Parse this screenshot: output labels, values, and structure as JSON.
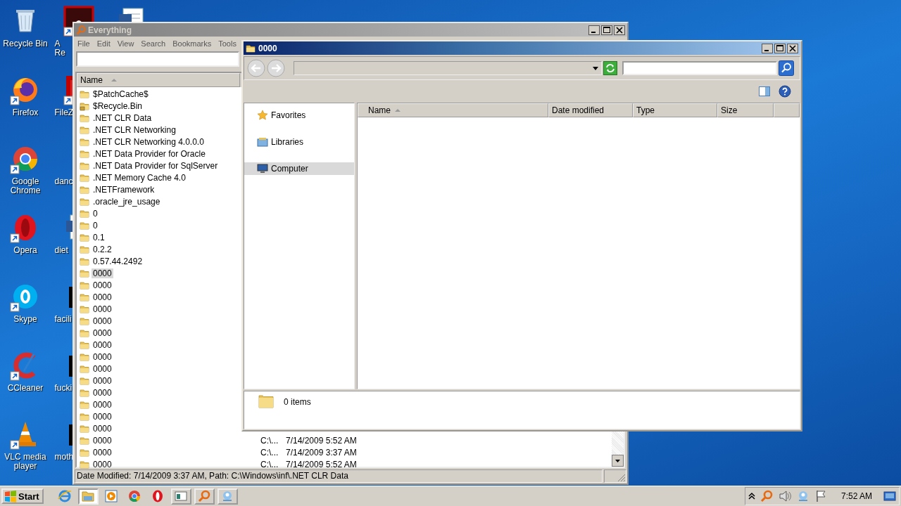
{
  "desktop": {
    "columns": [
      {
        "icons": [
          {
            "label": "Recycle Bin",
            "kind": "recycle",
            "shortcut": false
          },
          {
            "label": "Firefox",
            "kind": "firefox",
            "shortcut": true
          },
          {
            "label": "Google Chrome",
            "kind": "chrome",
            "shortcut": true
          },
          {
            "label": "Opera",
            "kind": "opera",
            "shortcut": true
          },
          {
            "label": "Skype",
            "kind": "skype",
            "shortcut": true
          },
          {
            "label": "CCleaner",
            "kind": "ccleaner",
            "shortcut": true
          },
          {
            "label": "VLC media player",
            "kind": "vlc",
            "shortcut": true
          }
        ]
      },
      {
        "icons": [
          {
            "label": "A Re",
            "kind": "acrobat",
            "shortcut": true
          },
          {
            "label": "FileZ",
            "kind": "filezilla",
            "shortcut": true
          },
          {
            "label": "danc",
            "kind": "blank"
          },
          {
            "label": "diet",
            "kind": "word",
            "shortcut": false
          },
          {
            "label": "facili",
            "kind": "black",
            "shortcut": false
          },
          {
            "label": "fucki",
            "kind": "black",
            "shortcut": false
          },
          {
            "label": "moth",
            "kind": "black",
            "shortcut": false
          }
        ]
      },
      {
        "icons": [
          {
            "kind": "word"
          }
        ]
      }
    ]
  },
  "everything": {
    "title": "Everything",
    "active": false,
    "menu": [
      "File",
      "Edit",
      "View",
      "Search",
      "Bookmarks",
      "Tools"
    ],
    "columns": [
      {
        "label": "Name",
        "sorted": true
      }
    ],
    "rows": [
      {
        "name": "$PatchCache$",
        "kind": "folder",
        "selected": false
      },
      {
        "name": "$Recycle.Bin",
        "kind": "locked",
        "selected": false
      },
      {
        "name": ".NET CLR Data",
        "kind": "folder",
        "selected": false
      },
      {
        "name": ".NET CLR Networking",
        "kind": "folder",
        "selected": false
      },
      {
        "name": ".NET CLR Networking 4.0.0.0",
        "kind": "folder",
        "selected": false
      },
      {
        "name": ".NET Data Provider for Oracle",
        "kind": "folder",
        "selected": false
      },
      {
        "name": ".NET Data Provider for SqlServer",
        "kind": "folder",
        "selected": false
      },
      {
        "name": ".NET Memory Cache 4.0",
        "kind": "folder",
        "selected": false
      },
      {
        "name": ".NETFramework",
        "kind": "folder",
        "selected": false
      },
      {
        "name": ".oracle_jre_usage",
        "kind": "folder",
        "selected": false
      },
      {
        "name": "0",
        "kind": "folder",
        "selected": false
      },
      {
        "name": "0",
        "kind": "folder",
        "selected": false
      },
      {
        "name": "0.1",
        "kind": "folder",
        "selected": false
      },
      {
        "name": "0.2.2",
        "kind": "folder",
        "selected": false
      },
      {
        "name": "0.57.44.2492",
        "kind": "folder",
        "selected": false
      },
      {
        "name": "0000",
        "kind": "folder",
        "selected": true
      },
      {
        "name": "0000",
        "kind": "folder",
        "selected": false
      },
      {
        "name": "0000",
        "kind": "folder",
        "selected": false
      },
      {
        "name": "0000",
        "kind": "folder",
        "selected": false
      },
      {
        "name": "0000",
        "kind": "folder",
        "selected": false
      },
      {
        "name": "0000",
        "kind": "folder",
        "selected": false
      },
      {
        "name": "0000",
        "kind": "folder",
        "selected": false
      },
      {
        "name": "0000",
        "kind": "folder",
        "selected": false
      },
      {
        "name": "0000",
        "kind": "folder",
        "selected": false
      },
      {
        "name": "0000",
        "kind": "folder",
        "selected": false
      },
      {
        "name": "0000",
        "kind": "folder",
        "selected": false
      },
      {
        "name": "0000",
        "kind": "folder",
        "selected": false
      },
      {
        "name": "0000",
        "kind": "folder",
        "selected": false
      },
      {
        "name": "0000",
        "kind": "folder",
        "selected": false
      },
      {
        "name": "0000",
        "kind": "folder",
        "selected": false,
        "path": "C:\\...",
        "modified": "7/14/2009 5:52 AM"
      },
      {
        "name": "0000",
        "kind": "folder",
        "selected": false,
        "path": "C:\\...",
        "modified": "7/14/2009 3:37 AM"
      },
      {
        "name": "0000",
        "kind": "folder",
        "selected": false,
        "path": "C:\\...",
        "modified": "7/14/2009 5:52 AM"
      }
    ],
    "status": "Date Modified: 7/14/2009 3:37 AM, Path: C:\\Windows\\inf\\.NET CLR Data"
  },
  "explorer": {
    "title": "0000",
    "active": true,
    "nav": [
      {
        "label": "Favorites",
        "kind": "favorites",
        "selected": false
      },
      {
        "label": "Libraries",
        "kind": "libraries",
        "selected": false
      },
      {
        "label": "Computer",
        "kind": "computer",
        "selected": true
      }
    ],
    "columns": [
      {
        "label": "Name",
        "sorted": true
      },
      {
        "label": "Date modified",
        "sorted": false
      },
      {
        "label": "Type",
        "sorted": false
      },
      {
        "label": "Size",
        "sorted": false
      }
    ],
    "details": "0 items"
  },
  "taskbar": {
    "start": "Start",
    "items": [
      {
        "kind": "ie",
        "active": false,
        "framed": false
      },
      {
        "kind": "explorer",
        "active": true,
        "framed": true
      },
      {
        "kind": "media",
        "active": false,
        "framed": false
      },
      {
        "kind": "chrome",
        "active": false,
        "framed": false
      },
      {
        "kind": "opera",
        "active": false,
        "framed": false
      },
      {
        "kind": "window",
        "active": false,
        "framed": true
      },
      {
        "kind": "search",
        "active": false,
        "framed": true
      },
      {
        "kind": "network",
        "active": false,
        "framed": true
      }
    ],
    "tray": [
      {
        "kind": "chevron"
      },
      {
        "kind": "search"
      },
      {
        "kind": "volume"
      },
      {
        "kind": "network"
      },
      {
        "kind": "flag"
      }
    ],
    "clock": "7:52 AM"
  }
}
